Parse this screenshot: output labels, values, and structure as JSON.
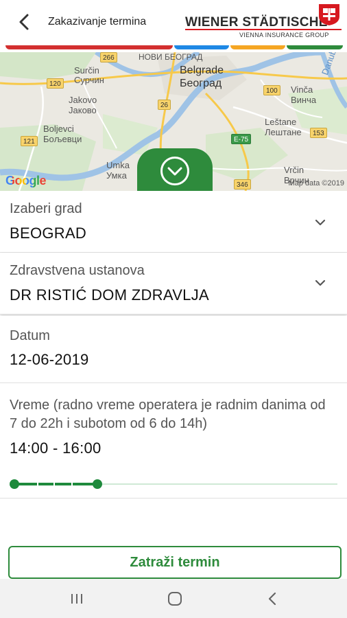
{
  "header": {
    "title": "Zakazivanje termina",
    "logo": {
      "main": "WIENER STÄDTISCHE",
      "sub": "VIENNA INSURANCE GROUP"
    }
  },
  "colors": {
    "brand_green": "#2e8b3c",
    "brand_red": "#d71920",
    "strip": [
      "#d32f2f",
      "#1e88e5",
      "#f5a623",
      "#2e8b3c"
    ]
  },
  "map": {
    "labels": {
      "novi_beograd": "НОВИ БЕОГРАД",
      "belgrade": "Belgrade",
      "beograd_cyr": "Београд",
      "surcin": "Surčin",
      "surcin_cyr": "Сурчин",
      "jakovo": "Jakovo",
      "jakovo_cyr": "Јаково",
      "boljevci": "Boljevci",
      "boljevci_cyr": "Бољевци",
      "umka": "Umka",
      "umka_cyr": "Умка",
      "vinca": "Vinča",
      "vinca_cyr": "Винча",
      "lestane": "Leštane",
      "lestane_cyr": "Лештане",
      "vrcin": "Vrčin",
      "vrcin_cyr": "Врчин",
      "danube": "Danube"
    },
    "shields": {
      "r266": "266",
      "r120": "120",
      "r26": "26",
      "r100": "100",
      "r121": "121",
      "e75": "E-75",
      "r153": "153",
      "r346": "346"
    },
    "google": "Google",
    "attribution": "Map data ©2019"
  },
  "form": {
    "city": {
      "label": "Izaberi grad",
      "value": "BEOGRAD"
    },
    "institution": {
      "label": "Zdravstvena ustanova",
      "value": "DR RISTIĆ DOM ZDRAVLJA"
    },
    "date": {
      "label": "Datum",
      "value": "12-06-2019"
    },
    "time": {
      "label": "Vreme (radno vreme operatera je radnim danima od 7 do 22h i subotom od 6 do 14h)",
      "value": "14:00 - 16:00",
      "range_start_fraction": 0.0,
      "range_end_fraction": 0.26
    }
  },
  "submit_label": "Zatraži termin",
  "navbar": {
    "icons": [
      "recent-apps-icon",
      "home-icon",
      "back-icon"
    ]
  }
}
